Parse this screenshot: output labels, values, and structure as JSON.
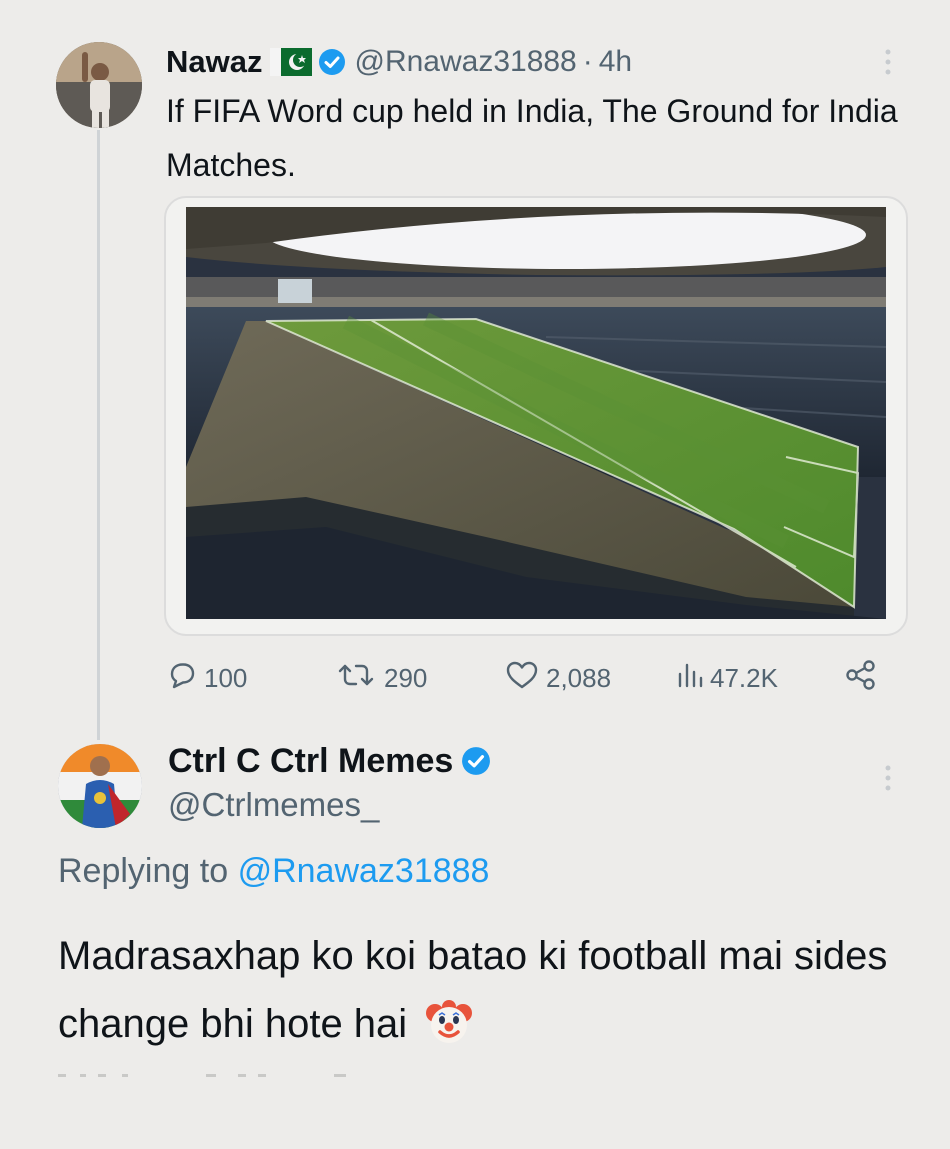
{
  "tweet": {
    "author_name": "Nawaz",
    "flag_icon": "pakistan-flag-icon",
    "handle": "@Rnawaz31888",
    "time_sep": "·",
    "time": "4h",
    "text": "If FIFA Word cup held in India, The Ground for India Matches.",
    "media_icon": "tilted-football-stadium-image",
    "actions": {
      "replies": "100",
      "retweets": "290",
      "likes": "2,088",
      "views": "47.2K"
    }
  },
  "reply": {
    "author_name": "Ctrl C Ctrl Memes",
    "handle": "@Ctrlmemes_",
    "replying_prefix": "Replying to",
    "replying_mention": "@Rnawaz31888",
    "text": "Madrasaxhap ko koi batao ki football mai sides change bhi hote hai",
    "emoji_icon": "clown-face-icon"
  },
  "colors": {
    "background": "#edecea",
    "text_primary": "#0f1419",
    "text_secondary": "#536471",
    "accent_blue": "#1d9bf0"
  }
}
